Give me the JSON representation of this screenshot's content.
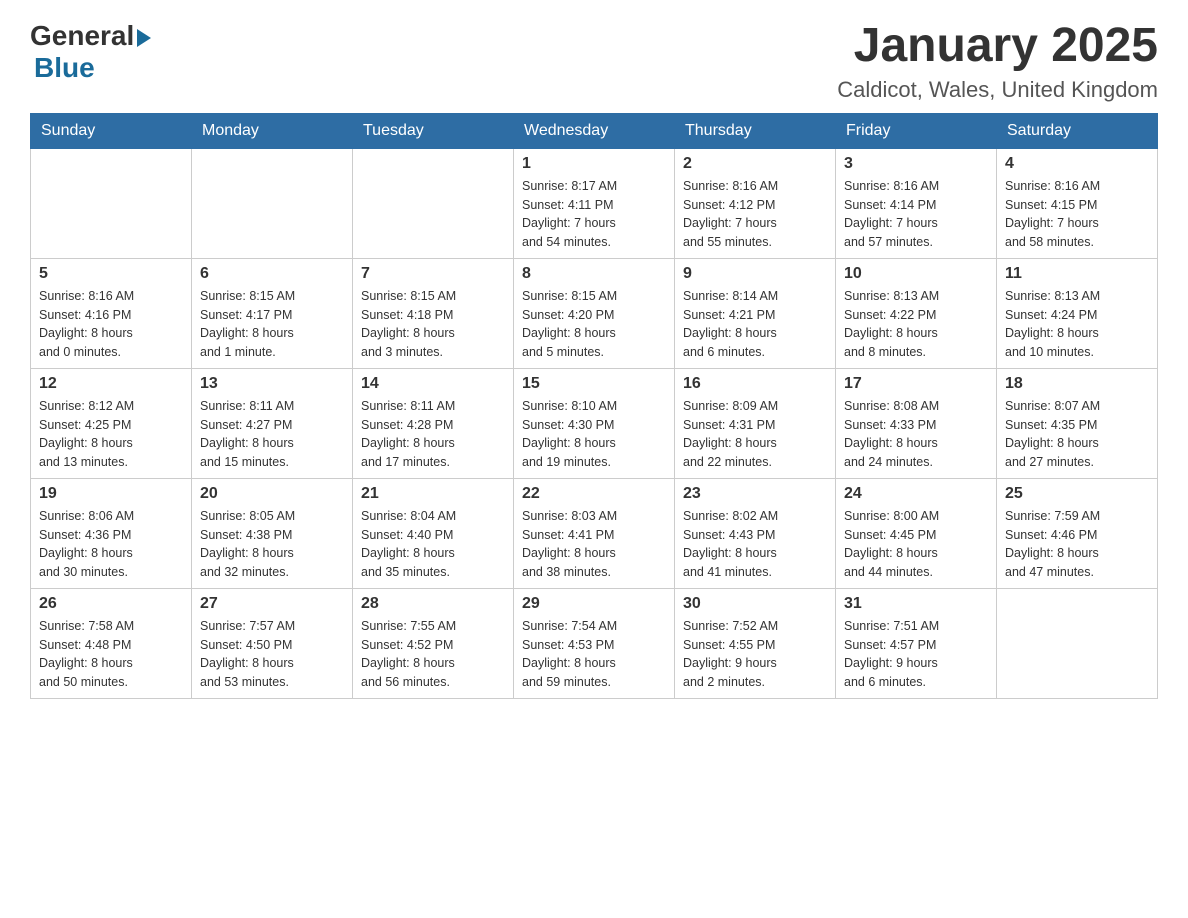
{
  "logo": {
    "general": "General",
    "blue": "Blue"
  },
  "header": {
    "title": "January 2025",
    "location": "Caldicot, Wales, United Kingdom"
  },
  "columns": [
    "Sunday",
    "Monday",
    "Tuesday",
    "Wednesday",
    "Thursday",
    "Friday",
    "Saturday"
  ],
  "weeks": [
    [
      {
        "day": "",
        "info": ""
      },
      {
        "day": "",
        "info": ""
      },
      {
        "day": "",
        "info": ""
      },
      {
        "day": "1",
        "info": "Sunrise: 8:17 AM\nSunset: 4:11 PM\nDaylight: 7 hours\nand 54 minutes."
      },
      {
        "day": "2",
        "info": "Sunrise: 8:16 AM\nSunset: 4:12 PM\nDaylight: 7 hours\nand 55 minutes."
      },
      {
        "day": "3",
        "info": "Sunrise: 8:16 AM\nSunset: 4:14 PM\nDaylight: 7 hours\nand 57 minutes."
      },
      {
        "day": "4",
        "info": "Sunrise: 8:16 AM\nSunset: 4:15 PM\nDaylight: 7 hours\nand 58 minutes."
      }
    ],
    [
      {
        "day": "5",
        "info": "Sunrise: 8:16 AM\nSunset: 4:16 PM\nDaylight: 8 hours\nand 0 minutes."
      },
      {
        "day": "6",
        "info": "Sunrise: 8:15 AM\nSunset: 4:17 PM\nDaylight: 8 hours\nand 1 minute."
      },
      {
        "day": "7",
        "info": "Sunrise: 8:15 AM\nSunset: 4:18 PM\nDaylight: 8 hours\nand 3 minutes."
      },
      {
        "day": "8",
        "info": "Sunrise: 8:15 AM\nSunset: 4:20 PM\nDaylight: 8 hours\nand 5 minutes."
      },
      {
        "day": "9",
        "info": "Sunrise: 8:14 AM\nSunset: 4:21 PM\nDaylight: 8 hours\nand 6 minutes."
      },
      {
        "day": "10",
        "info": "Sunrise: 8:13 AM\nSunset: 4:22 PM\nDaylight: 8 hours\nand 8 minutes."
      },
      {
        "day": "11",
        "info": "Sunrise: 8:13 AM\nSunset: 4:24 PM\nDaylight: 8 hours\nand 10 minutes."
      }
    ],
    [
      {
        "day": "12",
        "info": "Sunrise: 8:12 AM\nSunset: 4:25 PM\nDaylight: 8 hours\nand 13 minutes."
      },
      {
        "day": "13",
        "info": "Sunrise: 8:11 AM\nSunset: 4:27 PM\nDaylight: 8 hours\nand 15 minutes."
      },
      {
        "day": "14",
        "info": "Sunrise: 8:11 AM\nSunset: 4:28 PM\nDaylight: 8 hours\nand 17 minutes."
      },
      {
        "day": "15",
        "info": "Sunrise: 8:10 AM\nSunset: 4:30 PM\nDaylight: 8 hours\nand 19 minutes."
      },
      {
        "day": "16",
        "info": "Sunrise: 8:09 AM\nSunset: 4:31 PM\nDaylight: 8 hours\nand 22 minutes."
      },
      {
        "day": "17",
        "info": "Sunrise: 8:08 AM\nSunset: 4:33 PM\nDaylight: 8 hours\nand 24 minutes."
      },
      {
        "day": "18",
        "info": "Sunrise: 8:07 AM\nSunset: 4:35 PM\nDaylight: 8 hours\nand 27 minutes."
      }
    ],
    [
      {
        "day": "19",
        "info": "Sunrise: 8:06 AM\nSunset: 4:36 PM\nDaylight: 8 hours\nand 30 minutes."
      },
      {
        "day": "20",
        "info": "Sunrise: 8:05 AM\nSunset: 4:38 PM\nDaylight: 8 hours\nand 32 minutes."
      },
      {
        "day": "21",
        "info": "Sunrise: 8:04 AM\nSunset: 4:40 PM\nDaylight: 8 hours\nand 35 minutes."
      },
      {
        "day": "22",
        "info": "Sunrise: 8:03 AM\nSunset: 4:41 PM\nDaylight: 8 hours\nand 38 minutes."
      },
      {
        "day": "23",
        "info": "Sunrise: 8:02 AM\nSunset: 4:43 PM\nDaylight: 8 hours\nand 41 minutes."
      },
      {
        "day": "24",
        "info": "Sunrise: 8:00 AM\nSunset: 4:45 PM\nDaylight: 8 hours\nand 44 minutes."
      },
      {
        "day": "25",
        "info": "Sunrise: 7:59 AM\nSunset: 4:46 PM\nDaylight: 8 hours\nand 47 minutes."
      }
    ],
    [
      {
        "day": "26",
        "info": "Sunrise: 7:58 AM\nSunset: 4:48 PM\nDaylight: 8 hours\nand 50 minutes."
      },
      {
        "day": "27",
        "info": "Sunrise: 7:57 AM\nSunset: 4:50 PM\nDaylight: 8 hours\nand 53 minutes."
      },
      {
        "day": "28",
        "info": "Sunrise: 7:55 AM\nSunset: 4:52 PM\nDaylight: 8 hours\nand 56 minutes."
      },
      {
        "day": "29",
        "info": "Sunrise: 7:54 AM\nSunset: 4:53 PM\nDaylight: 8 hours\nand 59 minutes."
      },
      {
        "day": "30",
        "info": "Sunrise: 7:52 AM\nSunset: 4:55 PM\nDaylight: 9 hours\nand 2 minutes."
      },
      {
        "day": "31",
        "info": "Sunrise: 7:51 AM\nSunset: 4:57 PM\nDaylight: 9 hours\nand 6 minutes."
      },
      {
        "day": "",
        "info": ""
      }
    ]
  ]
}
